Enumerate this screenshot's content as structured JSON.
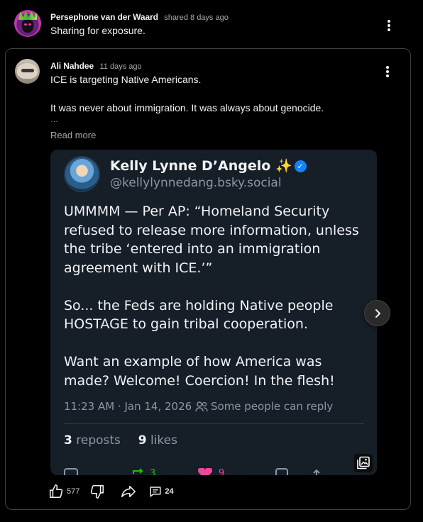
{
  "share": {
    "author": "Persephone van der Waard",
    "meta": "shared 8 days ago",
    "text": "Sharing for exposure."
  },
  "post": {
    "author": "Ali Nahdee",
    "meta": "11 days ago",
    "line1": "ICE is targeting Native Americans.",
    "line2": "It was never about immigration. It was always about genocide.",
    "ellipsis": "…",
    "read_more": "Read more"
  },
  "embed": {
    "name": "Kelly Lynne D’Angelo ✨",
    "handle": "@kellylynnedang.bsky.social",
    "paragraphs": [
      "UMMMM — Per AP: “Homeland Security refused to release more information, unless the tribe ‘entered into an immigration agreement with ICE.’”",
      "So... the Feds are holding Native people HOSTAGE to gain tribal cooperation.",
      "Want an example of how America was made? Welcome! Coercion! In the flesh!"
    ],
    "timestamp": "11:23 AM · Jan 14, 2026",
    "reply_setting": "Some people can reply",
    "reposts_count": "3",
    "reposts_label": "reposts",
    "likes_count": "9",
    "likes_label": "likes",
    "action_repost_count": "3",
    "action_like_count": "9"
  },
  "actions": {
    "like_count": "577",
    "comment_count": "24"
  },
  "colors": {
    "background": "#000000",
    "embed_bg": "#161e27",
    "verified": "#1185fe",
    "repost_green": "#20bc07",
    "like_pink": "#ec4899"
  },
  "icons": [
    "more-vert-icon",
    "verified-icon",
    "people-icon",
    "chevron-right-icon",
    "gallery-icon",
    "thumbs-up-icon",
    "thumbs-down-icon",
    "share-icon",
    "comment-icon"
  ]
}
